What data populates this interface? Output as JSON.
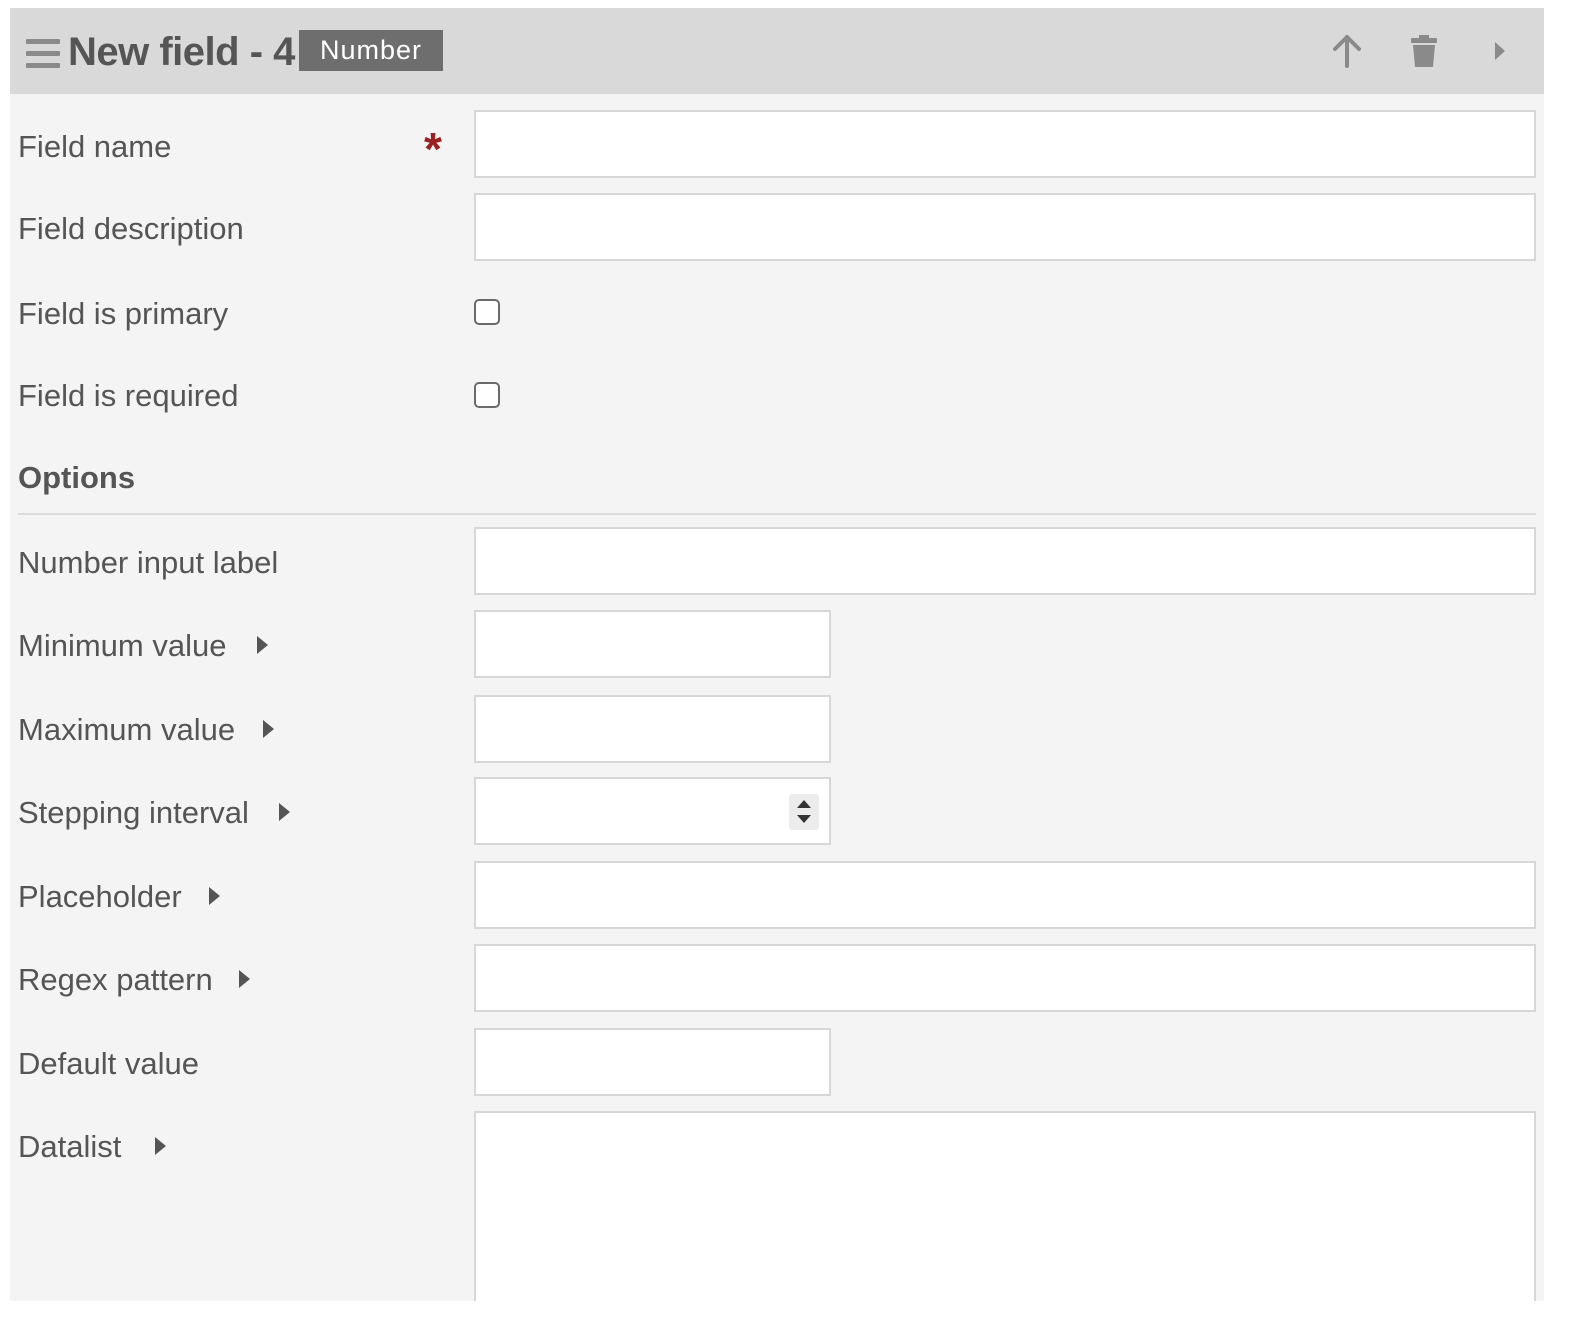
{
  "header": {
    "title": "New field - 4",
    "type_badge": "Number",
    "icons": [
      "drag-handle-icon",
      "arrow-up-icon",
      "trash-icon",
      "caret-right-icon"
    ]
  },
  "fields": {
    "field_name": {
      "label": "Field name",
      "required_mark": "*",
      "value": ""
    },
    "field_description": {
      "label": "Field description",
      "value": ""
    },
    "field_is_primary": {
      "label": "Field is primary",
      "checked": false
    },
    "field_is_required": {
      "label": "Field is required",
      "checked": false
    }
  },
  "options": {
    "title": "Options",
    "number_input_label": {
      "label": "Number input label",
      "value": ""
    },
    "minimum_value": {
      "label": "Minimum value",
      "value": ""
    },
    "maximum_value": {
      "label": "Maximum value",
      "value": ""
    },
    "stepping_interval": {
      "label": "Stepping interval",
      "value": ""
    },
    "placeholder": {
      "label": "Placeholder",
      "value": ""
    },
    "regex_pattern": {
      "label": "Regex pattern",
      "value": ""
    },
    "default_value": {
      "label": "Default value",
      "value": ""
    },
    "datalist": {
      "label": "Datalist",
      "value": ""
    }
  },
  "colors": {
    "header_bg": "#d9d9d9",
    "panel_bg": "#f4f4f4",
    "badge_bg": "#6e6e6e",
    "required_star": "#9b2222",
    "text": "#555555"
  }
}
